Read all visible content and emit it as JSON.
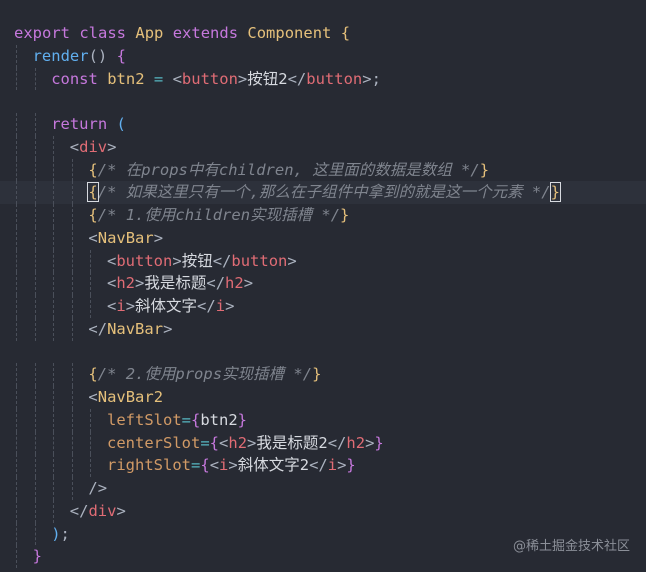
{
  "editor": {
    "lines": [
      {
        "indent": 0,
        "tokens": [
          {
            "t": "export",
            "c": "kw"
          },
          {
            "t": " "
          },
          {
            "t": "class",
            "c": "kw"
          },
          {
            "t": " "
          },
          {
            "t": "App",
            "c": "cls"
          },
          {
            "t": " "
          },
          {
            "t": "extends",
            "c": "kw"
          },
          {
            "t": " "
          },
          {
            "t": "Component",
            "c": "cls"
          },
          {
            "t": " "
          },
          {
            "t": "{",
            "c": "brace"
          }
        ]
      },
      {
        "indent": 1,
        "tokens": [
          {
            "t": "render",
            "c": "fn"
          },
          {
            "t": "()",
            "c": "punc"
          },
          {
            "t": " "
          },
          {
            "t": "{",
            "c": "kw"
          }
        ]
      },
      {
        "indent": 2,
        "tokens": [
          {
            "t": "const",
            "c": "kw"
          },
          {
            "t": " "
          },
          {
            "t": "btn2",
            "c": "var"
          },
          {
            "t": " "
          },
          {
            "t": "=",
            "c": "op"
          },
          {
            "t": " "
          },
          {
            "t": "<",
            "c": "punc"
          },
          {
            "t": "button",
            "c": "tag"
          },
          {
            "t": ">",
            "c": "punc"
          },
          {
            "t": "按钮2",
            "c": "txt"
          },
          {
            "t": "</",
            "c": "punc"
          },
          {
            "t": "button",
            "c": "tag"
          },
          {
            "t": ">",
            "c": "punc"
          },
          {
            "t": ";",
            "c": "punc"
          }
        ]
      },
      {
        "indent": 0,
        "tokens": []
      },
      {
        "indent": 2,
        "tokens": [
          {
            "t": "return",
            "c": "kw"
          },
          {
            "t": " "
          },
          {
            "t": "(",
            "c": "fn"
          }
        ]
      },
      {
        "indent": 3,
        "tokens": [
          {
            "t": "<",
            "c": "punc"
          },
          {
            "t": "div",
            "c": "tag"
          },
          {
            "t": ">",
            "c": "punc"
          }
        ]
      },
      {
        "indent": 4,
        "tokens": [
          {
            "t": "{",
            "c": "brace"
          },
          {
            "t": "/* 在props中有children, 这里面的数据是数组 */",
            "c": "cmt"
          },
          {
            "t": "}",
            "c": "brace"
          }
        ]
      },
      {
        "indent": 4,
        "hl": true,
        "tokens": [
          {
            "t": "{",
            "c": "brace",
            "box": true
          },
          {
            "t": "/* 如果这里只有一个,那么在子组件中拿到的就是这一个元素 */",
            "c": "cmt"
          },
          {
            "t": "}",
            "c": "brace",
            "box": true
          }
        ]
      },
      {
        "indent": 4,
        "tokens": [
          {
            "t": "{",
            "c": "brace"
          },
          {
            "t": "/* 1.使用children实现插槽 */",
            "c": "cmt"
          },
          {
            "t": "}",
            "c": "brace"
          }
        ]
      },
      {
        "indent": 4,
        "tokens": [
          {
            "t": "<",
            "c": "punc"
          },
          {
            "t": "NavBar",
            "c": "cls"
          },
          {
            "t": ">",
            "c": "punc"
          }
        ]
      },
      {
        "indent": 5,
        "tokens": [
          {
            "t": "<",
            "c": "punc"
          },
          {
            "t": "button",
            "c": "tag"
          },
          {
            "t": ">",
            "c": "punc"
          },
          {
            "t": "按钮",
            "c": "txt"
          },
          {
            "t": "</",
            "c": "punc"
          },
          {
            "t": "button",
            "c": "tag"
          },
          {
            "t": ">",
            "c": "punc"
          }
        ]
      },
      {
        "indent": 5,
        "tokens": [
          {
            "t": "<",
            "c": "punc"
          },
          {
            "t": "h2",
            "c": "tag"
          },
          {
            "t": ">",
            "c": "punc"
          },
          {
            "t": "我是标题",
            "c": "txt"
          },
          {
            "t": "</",
            "c": "punc"
          },
          {
            "t": "h2",
            "c": "tag"
          },
          {
            "t": ">",
            "c": "punc"
          }
        ]
      },
      {
        "indent": 5,
        "tokens": [
          {
            "t": "<",
            "c": "punc"
          },
          {
            "t": "i",
            "c": "tag"
          },
          {
            "t": ">",
            "c": "punc"
          },
          {
            "t": "斜体文字",
            "c": "txt"
          },
          {
            "t": "</",
            "c": "punc"
          },
          {
            "t": "i",
            "c": "tag"
          },
          {
            "t": ">",
            "c": "punc"
          }
        ]
      },
      {
        "indent": 4,
        "tokens": [
          {
            "t": "</",
            "c": "punc"
          },
          {
            "t": "NavBar",
            "c": "cls"
          },
          {
            "t": ">",
            "c": "punc"
          }
        ]
      },
      {
        "indent": 0,
        "tokens": []
      },
      {
        "indent": 4,
        "tokens": [
          {
            "t": "{",
            "c": "brace"
          },
          {
            "t": "/* 2.使用props实现插槽 */",
            "c": "cmt"
          },
          {
            "t": "}",
            "c": "brace"
          }
        ]
      },
      {
        "indent": 4,
        "tokens": [
          {
            "t": "<",
            "c": "punc"
          },
          {
            "t": "NavBar2",
            "c": "cls"
          }
        ]
      },
      {
        "indent": 5,
        "tokens": [
          {
            "t": "leftSlot",
            "c": "attr"
          },
          {
            "t": "=",
            "c": "op"
          },
          {
            "t": "{",
            "c": "kw"
          },
          {
            "t": "btn2",
            "c": "txt"
          },
          {
            "t": "}",
            "c": "kw"
          }
        ]
      },
      {
        "indent": 5,
        "tokens": [
          {
            "t": "centerSlot",
            "c": "attr"
          },
          {
            "t": "=",
            "c": "op"
          },
          {
            "t": "{",
            "c": "kw"
          },
          {
            "t": "<",
            "c": "punc"
          },
          {
            "t": "h2",
            "c": "tag"
          },
          {
            "t": ">",
            "c": "punc"
          },
          {
            "t": "我是标题2",
            "c": "txt"
          },
          {
            "t": "</",
            "c": "punc"
          },
          {
            "t": "h2",
            "c": "tag"
          },
          {
            "t": ">",
            "c": "punc"
          },
          {
            "t": "}",
            "c": "kw"
          }
        ]
      },
      {
        "indent": 5,
        "tokens": [
          {
            "t": "rightSlot",
            "c": "attr"
          },
          {
            "t": "=",
            "c": "op"
          },
          {
            "t": "{",
            "c": "kw"
          },
          {
            "t": "<",
            "c": "punc"
          },
          {
            "t": "i",
            "c": "tag"
          },
          {
            "t": ">",
            "c": "punc"
          },
          {
            "t": "斜体文字2",
            "c": "txt"
          },
          {
            "t": "</",
            "c": "punc"
          },
          {
            "t": "i",
            "c": "tag"
          },
          {
            "t": ">",
            "c": "punc"
          },
          {
            "t": "}",
            "c": "kw"
          }
        ]
      },
      {
        "indent": 4,
        "tokens": [
          {
            "t": "/>",
            "c": "punc"
          }
        ]
      },
      {
        "indent": 3,
        "tokens": [
          {
            "t": "</",
            "c": "punc"
          },
          {
            "t": "div",
            "c": "tag"
          },
          {
            "t": ">",
            "c": "punc"
          }
        ]
      },
      {
        "indent": 2,
        "tokens": [
          {
            "t": ")",
            "c": "fn"
          },
          {
            "t": ";",
            "c": "punc"
          }
        ]
      },
      {
        "indent": 1,
        "tokens": [
          {
            "t": "}",
            "c": "kw"
          }
        ]
      }
    ]
  },
  "watermark": "@稀土掘金技术社区",
  "colors": {
    "background": "#272a33",
    "keyword": "#c678dd",
    "tag": "#e06c75",
    "class": "#e5c07b",
    "function": "#61afef",
    "comment": "#7f848e"
  }
}
